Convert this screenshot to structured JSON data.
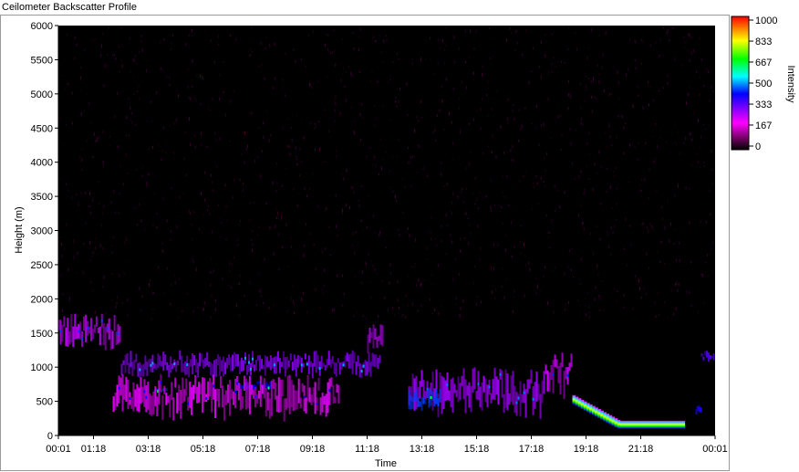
{
  "window": {
    "title": "Ceilometer Backscatter Profile"
  },
  "chart_data": {
    "type": "heatmap",
    "title": "",
    "xlabel": "Time",
    "ylabel": "Height (m)",
    "x_ticks": [
      "00:01",
      "01:18",
      "03:18",
      "05:18",
      "07:18",
      "09:18",
      "11:18",
      "13:18",
      "15:18",
      "17:18",
      "19:18",
      "21:18",
      "00:01"
    ],
    "x_tick_hours": [
      0.017,
      1.3,
      3.3,
      5.3,
      7.3,
      9.3,
      11.3,
      13.3,
      15.3,
      17.3,
      19.3,
      21.3,
      24.017
    ],
    "xlim_hours": [
      0.017,
      24.017
    ],
    "y_ticks": [
      0,
      500,
      1000,
      1500,
      2000,
      2500,
      3000,
      3500,
      4000,
      4500,
      5000,
      5500,
      6000
    ],
    "ylim": [
      0,
      6000
    ],
    "colorbar": {
      "label": "Intensity",
      "ticks": [
        1000,
        833,
        667,
        500,
        333,
        167,
        0
      ],
      "range": [
        0,
        1000
      ],
      "colors": [
        "#000000",
        "#6a005a",
        "#ff00ff",
        "#0000ff",
        "#00ffff",
        "#00ff00",
        "#ffff00",
        "#ff0000"
      ]
    },
    "background_noise_intensity": 60,
    "features": [
      {
        "name": "nocturnal boundary layer",
        "start_hour": 0.0,
        "end_hour": 2.3,
        "top_height": 1800,
        "base_height": 1050,
        "intensity": 250
      },
      {
        "name": "residual layer",
        "start_hour": 2.3,
        "end_hour": 11.8,
        "top_height": 1250,
        "base_height": 700,
        "intensity": 300
      },
      {
        "name": "rising layer",
        "start_hour": 11.3,
        "end_hour": 11.9,
        "top_height": 1650,
        "base_height": 1050,
        "intensity": 260
      },
      {
        "name": "cloud patch",
        "start_hour": 3.5,
        "end_hour": 4.0,
        "top_height": 700,
        "base_height": 600,
        "intensity": 450
      },
      {
        "name": "cloud patch",
        "start_hour": 6.6,
        "end_hour": 7.8,
        "top_height": 800,
        "base_height": 600,
        "intensity": 420
      },
      {
        "name": "precipitation streaks",
        "start_hour": 2.0,
        "end_hour": 10.3,
        "top_height": 900,
        "base_height": 0,
        "intensity": 220
      },
      {
        "name": "afternoon convective layer",
        "start_hour": 12.8,
        "end_hour": 17.8,
        "top_height": 1000,
        "base_height": 0,
        "intensity": 280
      },
      {
        "name": "descending cloud base",
        "start_hour": 12.8,
        "end_hour": 14.0,
        "top_height": 700,
        "base_height": 200,
        "intensity": 450
      },
      {
        "name": "evening residual",
        "start_hour": 17.8,
        "end_hour": 18.8,
        "top_height": 1250,
        "base_height": 300,
        "intensity": 240
      },
      {
        "name": "low cloud layer",
        "start_hour": 18.8,
        "end_hour": 22.9,
        "top_height": 550,
        "base_height": 50,
        "intensity": 950
      },
      {
        "name": "late cloud",
        "start_hour": 23.5,
        "end_hour": 24.0,
        "top_height": 1250,
        "base_height": 1000,
        "intensity": 350
      },
      {
        "name": "late cloud",
        "start_hour": 23.3,
        "end_hour": 23.5,
        "top_height": 450,
        "base_height": 250,
        "intensity": 400
      }
    ]
  }
}
